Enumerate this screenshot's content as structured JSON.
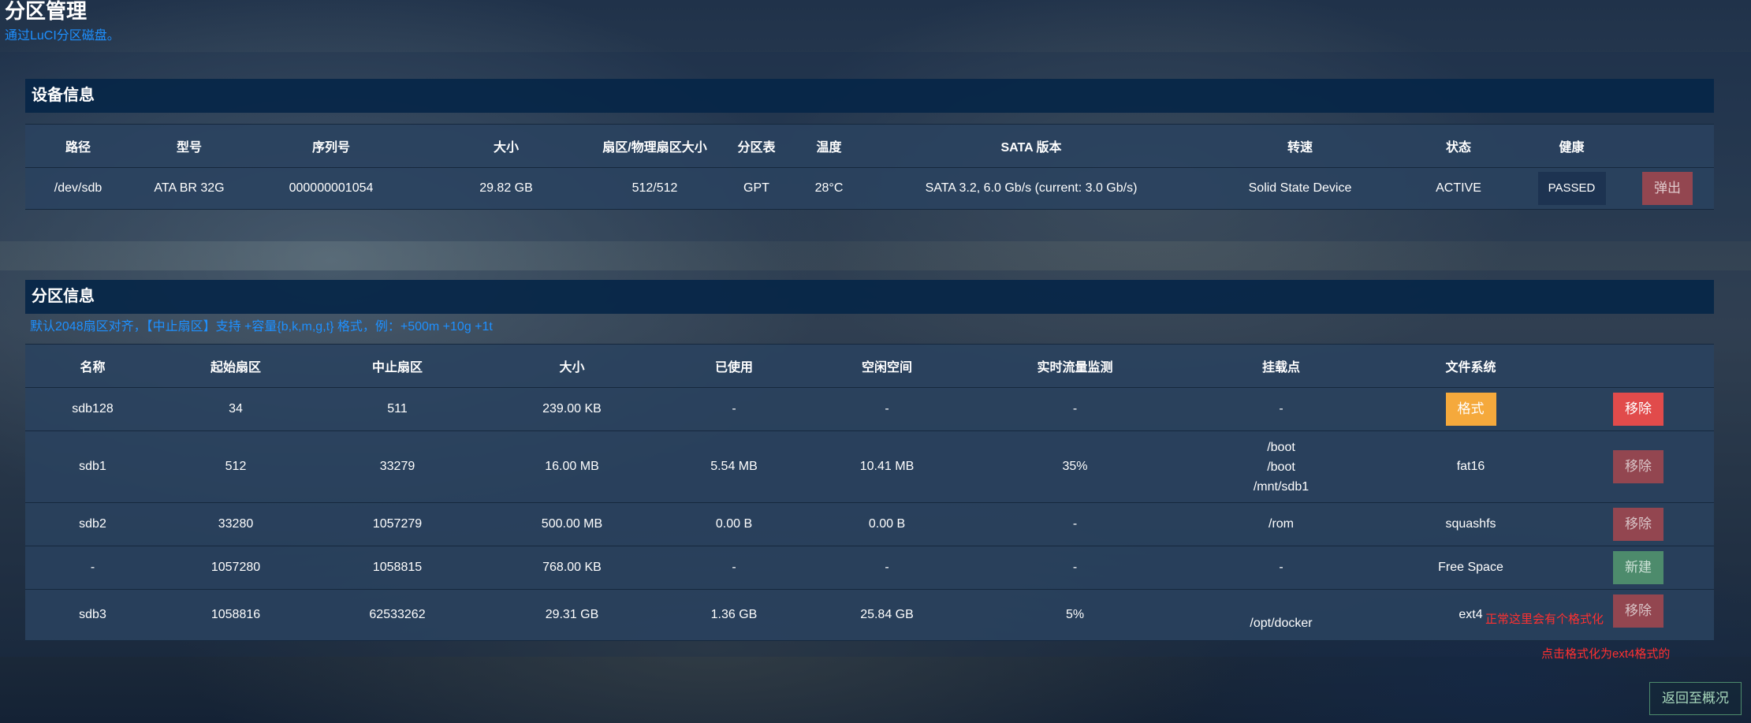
{
  "page": {
    "title": "分区管理",
    "description": "通过LuCI分区磁盘。"
  },
  "device_section": {
    "title": "设备信息",
    "columns": [
      "路径",
      "型号",
      "序列号",
      "大小",
      "扇区/物理扇区大小",
      "分区表",
      "温度",
      "SATA 版本",
      "转速",
      "状态",
      "健康",
      ""
    ],
    "row": {
      "path": "/dev/sdb",
      "model": "ATA BR 32G",
      "serial": "000000001054",
      "size": "29.82 GB",
      "sector_size": "512/512",
      "partition_table": "GPT",
      "temperature": "28°C",
      "sata_version": "SATA 3.2, 6.0 Gb/s (current: 3.0 Gb/s)",
      "rotation": "Solid State Device",
      "status": "ACTIVE",
      "health": "PASSED",
      "eject_label": "弹出"
    }
  },
  "partition_section": {
    "title": "分区信息",
    "note": "默认2048扇区对齐，【中止扇区】支持 +容量{b,k,m,g,t} 格式，例：+500m +10g +1t",
    "columns": [
      "名称",
      "起始扇区",
      "中止扇区",
      "大小",
      "已使用",
      "空闲空间",
      "实时流量监测",
      "挂载点",
      "文件系统",
      ""
    ],
    "rows": [
      {
        "name": "sdb128",
        "start": "34",
        "end": "511",
        "size": "239.00 KB",
        "used": "-",
        "free": "-",
        "usage": "-",
        "mount": [
          "-"
        ],
        "fs": "",
        "action": "移除",
        "fs_button": "格式"
      },
      {
        "name": "sdb1",
        "start": "512",
        "end": "33279",
        "size": "16.00 MB",
        "used": "5.54 MB",
        "free": "10.41 MB",
        "usage": "35%",
        "mount": [
          "/boot",
          "/boot",
          "/mnt/sdb1"
        ],
        "fs": "fat16",
        "action": "移除"
      },
      {
        "name": "sdb2",
        "start": "33280",
        "end": "1057279",
        "size": "500.00 MB",
        "used": "0.00 B",
        "free": "0.00 B",
        "usage": "-",
        "mount": [
          "/rom"
        ],
        "fs": "squashfs",
        "action": "移除"
      },
      {
        "name": "-",
        "start": "1057280",
        "end": "1058815",
        "size": "768.00 KB",
        "used": "-",
        "free": "-",
        "usage": "-",
        "mount": [
          "-"
        ],
        "fs": "Free Space",
        "action": "新建"
      },
      {
        "name": "sdb3",
        "start": "1058816",
        "end": "62533262",
        "size": "29.31 GB",
        "used": "1.36 GB",
        "free": "25.84 GB",
        "usage": "5%",
        "mount": [
          "/opt/docker"
        ],
        "fs": "ext4",
        "action": "移除"
      }
    ],
    "annotation_1": "正常这里会有个格式化",
    "annotation_2": "点击格式化为ext4格式的"
  },
  "back_button": "返回至概况",
  "colors": {
    "header_bg": "#062648",
    "link_blue": "#1e90ff",
    "remove_red": "#e14b4b",
    "format_orange": "#f5a93c",
    "new_green": "#4d8b6c",
    "annotation_red": "#ff3030"
  }
}
